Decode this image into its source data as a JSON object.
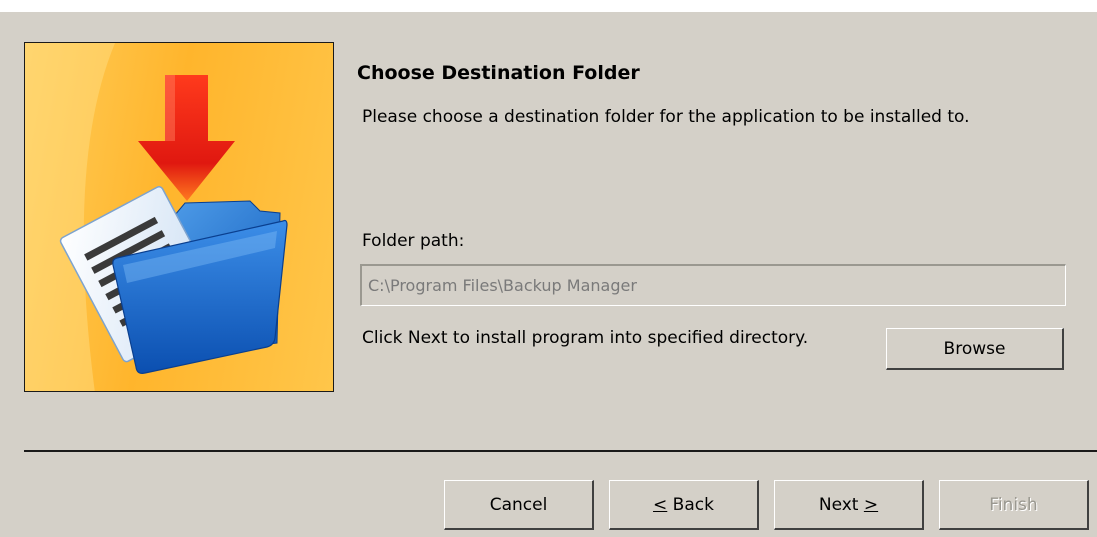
{
  "header": {
    "title": "Choose Destination Folder",
    "description": "Please choose a destination folder for the application to be installed to."
  },
  "banner": {
    "icon": "download-folder-icon"
  },
  "folder": {
    "label": "Folder path:",
    "value": "C:\\Program Files\\Backup Manager",
    "hint": "Click Next to install program into specified directory.",
    "browse_label": "Browse"
  },
  "buttons": {
    "cancel": "Cancel",
    "back_mnemonic": "<",
    "back_rest": " Back",
    "next_pre": "Next ",
    "next_mnemonic": ">",
    "finish": "Finish"
  }
}
